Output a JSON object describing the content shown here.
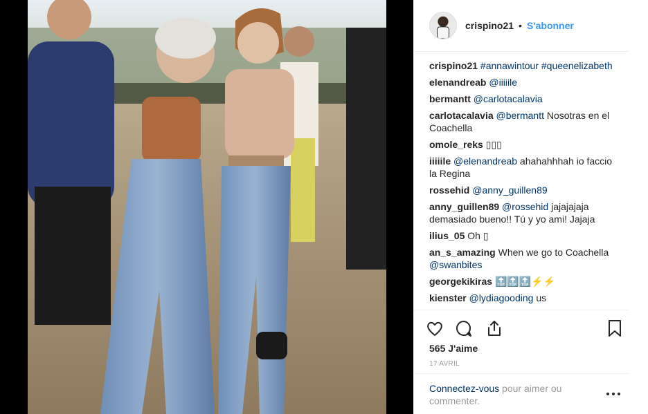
{
  "post": {
    "username": "crispino21",
    "follow_label": "S'abonner",
    "separator": "•"
  },
  "comments": [
    {
      "author": "crispino21",
      "parts": [
        {
          "kind": "link",
          "text": "#annawintour"
        },
        {
          "kind": "text",
          "text": " "
        },
        {
          "kind": "link",
          "text": "#queenelizabeth"
        }
      ]
    },
    {
      "author": "elenandreab",
      "parts": [
        {
          "kind": "link",
          "text": "@iiiiile"
        }
      ]
    },
    {
      "author": "bermantt",
      "parts": [
        {
          "kind": "link",
          "text": "@carlotacalavia"
        }
      ]
    },
    {
      "author": "carlotacalavia",
      "parts": [
        {
          "kind": "link",
          "text": "@bermantt"
        },
        {
          "kind": "text",
          "text": " Nosotras en el Coachella"
        }
      ]
    },
    {
      "author": "omole_reks",
      "parts": [
        {
          "kind": "text",
          "text": "▯▯▯"
        }
      ]
    },
    {
      "author": "iiiiile",
      "parts": [
        {
          "kind": "link",
          "text": "@elenandreab"
        },
        {
          "kind": "text",
          "text": " ahahahhhah io faccio la Regina"
        }
      ]
    },
    {
      "author": "rossehid",
      "parts": [
        {
          "kind": "link",
          "text": "@anny_guillen89"
        }
      ]
    },
    {
      "author": "anny_guillen89",
      "parts": [
        {
          "kind": "link",
          "text": "@rossehid"
        },
        {
          "kind": "text",
          "text": " jajajajaja demasiado bueno!! Tú y yo ami! Jajaja"
        }
      ]
    },
    {
      "author": "ilius_05",
      "parts": [
        {
          "kind": "text",
          "text": "Oh ▯"
        }
      ]
    },
    {
      "author": "an_s_amazing",
      "parts": [
        {
          "kind": "text",
          "text": "When we go to Coachella "
        },
        {
          "kind": "link",
          "text": "@swanbites"
        }
      ]
    },
    {
      "author": "georgekikiras",
      "parts": [
        {
          "kind": "text",
          "text": "🔝🔝🔝⚡⚡"
        }
      ]
    },
    {
      "author": "kienster",
      "parts": [
        {
          "kind": "link",
          "text": "@lydiagooding"
        },
        {
          "kind": "text",
          "text": " us"
        }
      ]
    }
  ],
  "actions": {
    "like_icon": "heart-icon",
    "comment_icon": "comment-icon",
    "share_icon": "share-icon",
    "save_icon": "bookmark-icon"
  },
  "likes_label": "565 J'aime",
  "date_label": "17 AVRIL",
  "login": {
    "link_text": "Connectez-vous",
    "rest_text": " pour aimer ou commenter."
  },
  "more_icon": "more-options-icon"
}
